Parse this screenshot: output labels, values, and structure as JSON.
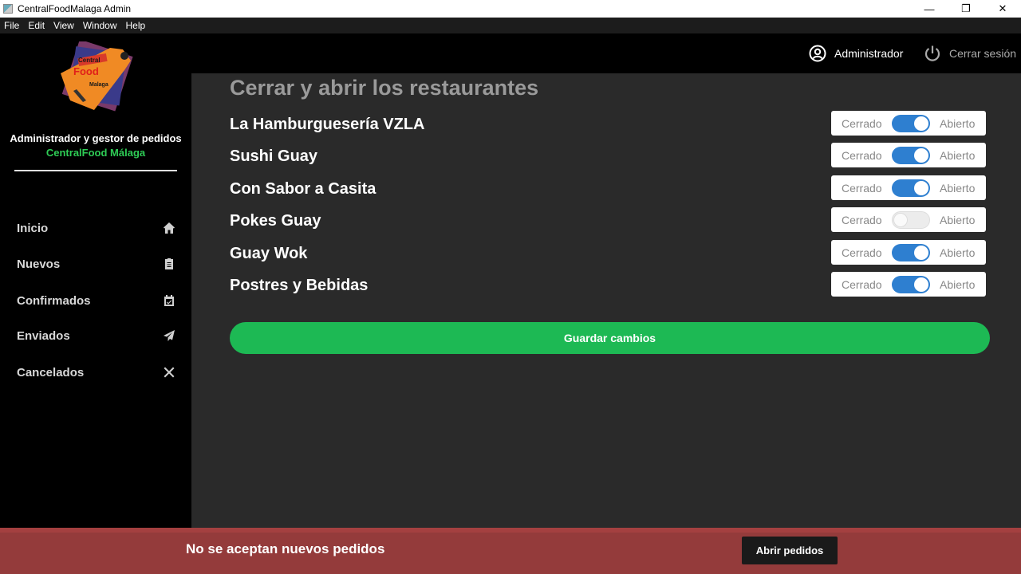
{
  "window": {
    "title": "CentralFoodMalaga Admin",
    "minimize": "—",
    "restore": "❐",
    "close": "✕"
  },
  "menu": [
    "File",
    "Edit",
    "View",
    "Window",
    "Help"
  ],
  "logo": {
    "line1": "Central",
    "line2": "Food",
    "line3": "Malaga"
  },
  "sidebar": {
    "subtitle": "Administrador y gestor de pedidos",
    "brand": "CentralFood Málaga",
    "items": [
      {
        "label": "Inicio",
        "icon": "home-icon"
      },
      {
        "label": "Nuevos",
        "icon": "clipboard-icon"
      },
      {
        "label": "Confirmados",
        "icon": "calendar-check-icon"
      },
      {
        "label": "Enviados",
        "icon": "paper-plane-icon"
      },
      {
        "label": "Cancelados",
        "icon": "x-icon"
      }
    ]
  },
  "header": {
    "user": "Administrador",
    "logout": "Cerrar sesión"
  },
  "main": {
    "title": "Cerrar y abrir los restaurantes",
    "off_label": "Cerrado",
    "on_label": "Abierto",
    "restaurants": [
      {
        "name": "La Hamburguesería VZLA",
        "open": true
      },
      {
        "name": "Sushi Guay",
        "open": true
      },
      {
        "name": "Con Sabor a Casita",
        "open": true
      },
      {
        "name": "Pokes Guay",
        "open": false
      },
      {
        "name": "Guay Wok",
        "open": true
      },
      {
        "name": "Postres y Bebidas",
        "open": true
      }
    ],
    "save_label": "Guardar cambios"
  },
  "banner": {
    "text": "No se aceptan nuevos pedidos",
    "button": "Abrir pedidos"
  },
  "colors": {
    "accent_green": "#1db954",
    "toggle_on": "#2e7fd0",
    "banner_red": "#943b3b"
  }
}
